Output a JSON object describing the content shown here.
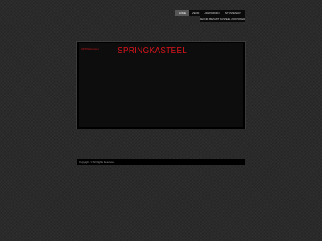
{
  "nav": {
    "row1": [
      {
        "label": "HOME",
        "active": true
      },
      {
        "label": "VERIF",
        "active": false
      },
      {
        "label": "LID WORDEN",
        "active": false
      },
      {
        "label": "INTUSSENAKT",
        "active": false
      }
    ],
    "row2": [
      {
        "label": "REÜNIE BEPAMT KASTEEL 2 OKTOBER 2016",
        "active": false
      }
    ]
  },
  "header": {
    "logo_text": "SPRINGKasteel",
    "site_title": "SPRINGKASTEEL"
  },
  "footer": {
    "copyright": "Copyright. © All Rights Reserved."
  },
  "colors": {
    "background": "#2a2a2a",
    "accent_red": "#d4141c",
    "nav_background": "#0a0a0a",
    "nav_active": "#565656"
  }
}
